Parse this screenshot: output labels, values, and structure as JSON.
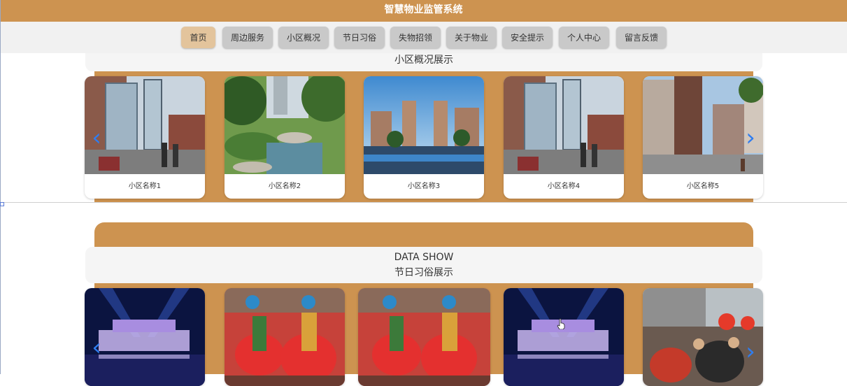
{
  "header": {
    "title": "智慧物业监管系统"
  },
  "nav": {
    "items": [
      {
        "label": "首页",
        "active": true
      },
      {
        "label": "周边服务",
        "active": false
      },
      {
        "label": "小区概况",
        "active": false
      },
      {
        "label": "节日习俗",
        "active": false
      },
      {
        "label": "失物招领",
        "active": false
      },
      {
        "label": "关于物业",
        "active": false
      },
      {
        "label": "安全提示",
        "active": false
      },
      {
        "label": "个人中心",
        "active": false
      },
      {
        "label": "留言反馈",
        "active": false
      }
    ]
  },
  "community": {
    "title": "小区概况展示",
    "cards": [
      {
        "caption": "小区名称1",
        "image": "building-elevator-photo"
      },
      {
        "caption": "小区名称2",
        "image": "garden-pond-photo"
      },
      {
        "caption": "小区名称3",
        "image": "towers-pool-photo"
      },
      {
        "caption": "小区名称4",
        "image": "building-elevator-photo"
      },
      {
        "caption": "小区名称5",
        "image": "apartment-street-photo"
      }
    ],
    "prev_icon": "chevron-left-icon",
    "next_icon": "chevron-right-icon"
  },
  "festival": {
    "subtitle": "DATA SHOW",
    "title": "节日习俗展示",
    "cards": [
      {
        "image": "night-lanterns-photo"
      },
      {
        "image": "folk-dance-photo"
      },
      {
        "image": "folk-dance-photo"
      },
      {
        "image": "night-lanterns-photo"
      },
      {
        "image": "parade-photo"
      }
    ],
    "prev_icon": "chevron-left-icon",
    "next_icon": "chevron-right-icon"
  },
  "colors": {
    "brand": "#cd9350",
    "nav_background": "#f1f1f1",
    "nav_button": "#c9c9c9",
    "nav_active": "#e3c49c",
    "arrow": "#2f7df0"
  }
}
